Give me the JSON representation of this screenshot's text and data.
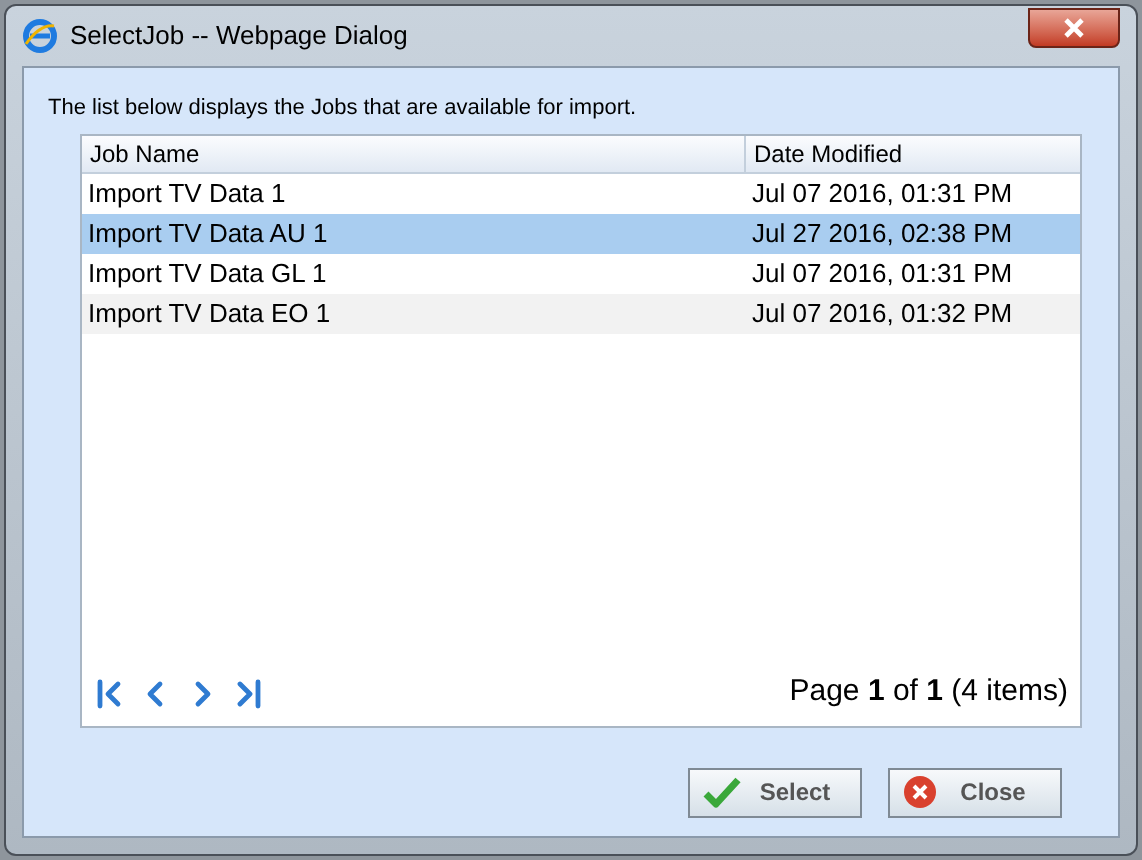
{
  "window": {
    "title": "SelectJob -- Webpage Dialog"
  },
  "intro": "The list below displays the Jobs that are available for import.",
  "table": {
    "columns": [
      "Job Name",
      "Date Modified"
    ],
    "rows": [
      {
        "cells": [
          "Import TV Data 1",
          "Jul 07 2016, 01:31 PM"
        ],
        "selected": false
      },
      {
        "cells": [
          "Import TV Data AU 1",
          "Jul 27 2016, 02:38 PM"
        ],
        "selected": true
      },
      {
        "cells": [
          "Import TV Data GL 1",
          "Jul 07 2016, 01:31 PM"
        ],
        "selected": false
      },
      {
        "cells": [
          "Import TV Data EO 1",
          "Jul 07 2016, 01:32 PM"
        ],
        "selected": false
      }
    ]
  },
  "pager": {
    "summary": "Page **1** of **1** (4 items)"
  },
  "buttons": [
    {
      "kind": "select",
      "label": "Select"
    },
    {
      "kind": "close",
      "label": "Close"
    }
  ]
}
